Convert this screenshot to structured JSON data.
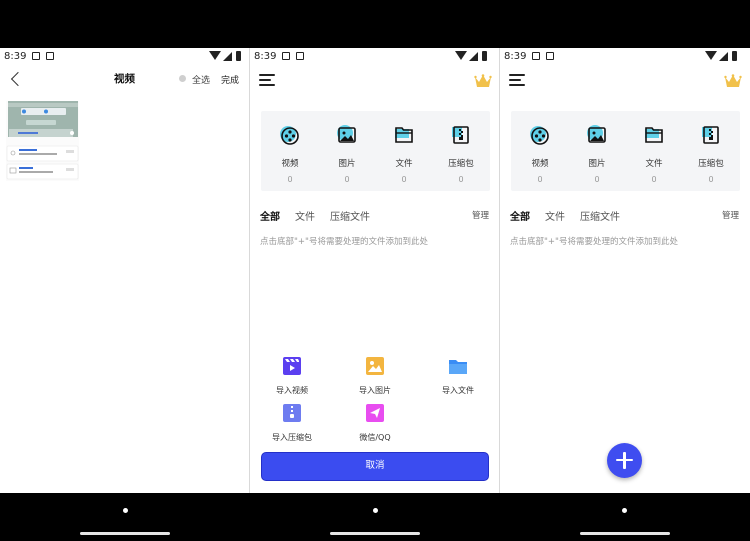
{
  "status": {
    "time": "8:39"
  },
  "screen1": {
    "title": "视频",
    "select_all": "全选",
    "done": "完成"
  },
  "home": {
    "categories": [
      {
        "label": "视频",
        "count": "0",
        "icon": "video-reel-icon"
      },
      {
        "label": "图片",
        "count": "0",
        "icon": "image-icon"
      },
      {
        "label": "文件",
        "count": "0",
        "icon": "folder-icon"
      },
      {
        "label": "压缩包",
        "count": "0",
        "icon": "zip-icon"
      }
    ],
    "tabs": [
      "全部",
      "文件",
      "压缩文件"
    ],
    "manage": "管理",
    "hint": "点击底部\"+\"号将需要处理的文件添加到此处"
  },
  "import_menu": {
    "items": [
      {
        "label": "导入视频",
        "icon": "clapperboard-icon",
        "color": "#5b3ff0"
      },
      {
        "label": "导入图片",
        "icon": "image-icon",
        "color": "#f3b53f"
      },
      {
        "label": "导入文件",
        "icon": "folder-icon",
        "color": "#3a8df5"
      },
      {
        "label": "导入压缩包",
        "icon": "zip-icon",
        "color": "#6e7cf0"
      },
      {
        "label": "微信/QQ",
        "icon": "send-icon",
        "color": "#e84df0"
      }
    ],
    "cancel": "取消"
  },
  "colors": {
    "accent": "#3b4cf0",
    "category_icon": "#5fd0e8"
  }
}
